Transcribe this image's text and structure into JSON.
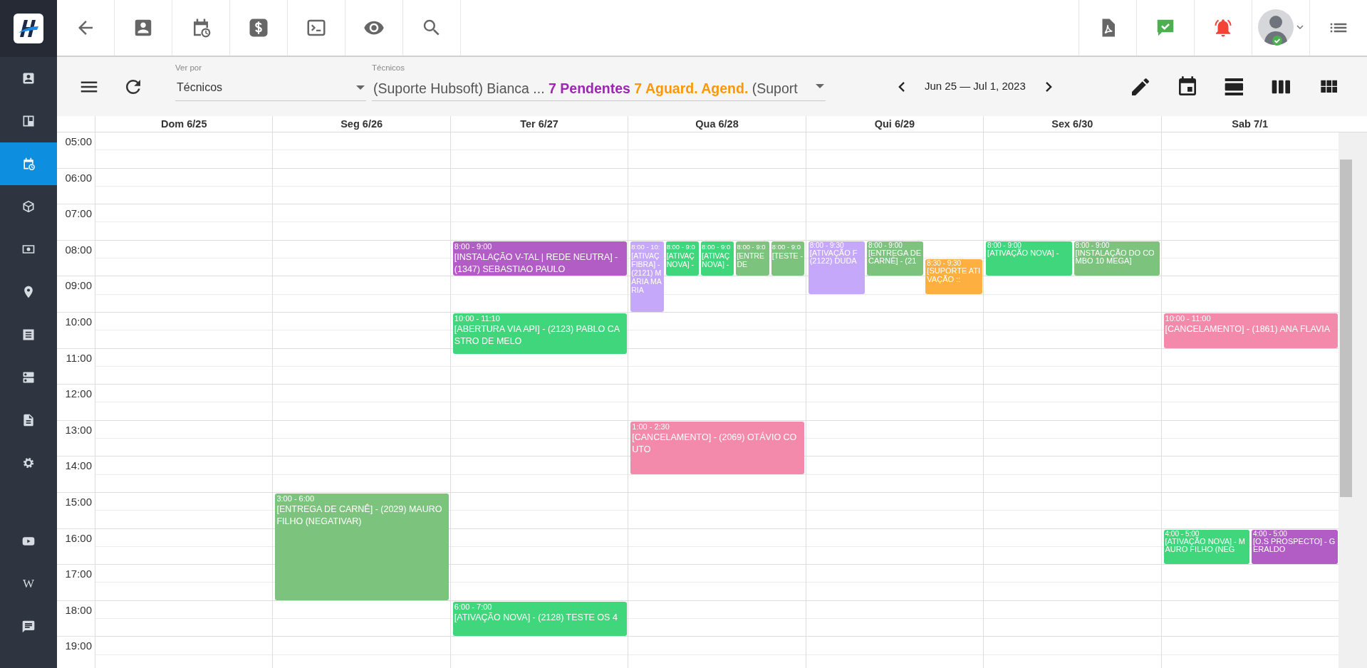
{
  "sidebar": {
    "items": [
      {
        "selected": false
      },
      {
        "selected": false
      },
      {
        "selected": true
      },
      {
        "selected": false
      },
      {
        "selected": false
      },
      {
        "selected": false
      },
      {
        "selected": false
      },
      {
        "selected": false
      },
      {
        "selected": false
      },
      {
        "selected": false
      },
      {
        "selected": false
      },
      {
        "selected": false,
        "label": "W"
      },
      {
        "selected": false
      }
    ]
  },
  "toolbar": {
    "view_by": {
      "label": "Ver por",
      "value": "Técnicos"
    },
    "technicians": {
      "label": "Técnicos",
      "prefix": "(Suporte Hubsoft) Bianca ...",
      "pending": "7 Pendentes",
      "awaiting": "7 Aguard. Agend.",
      "suffix": "(Suport"
    },
    "date_range": "Jun 25 — Jul 1, 2023"
  },
  "calendar": {
    "times": [
      "05:00",
      "06:00",
      "07:00",
      "08:00",
      "09:00",
      "10:00",
      "11:00",
      "12:00",
      "13:00",
      "14:00",
      "15:00",
      "16:00",
      "17:00",
      "18:00",
      "19:00"
    ],
    "days": [
      {
        "label": "Dom 6/25"
      },
      {
        "label": "Seg 6/26",
        "events": [
          {
            "time": "3:00 - 6:00",
            "title": "[ENTREGA DE CARNÊ] - (2029) MAURO FILHO (NEGATIVAR)",
            "color": "#7cc47e"
          }
        ]
      },
      {
        "label": "Ter 6/27",
        "events": [
          {
            "time": "8:00 - 9:00",
            "title": "[INSTALAÇÃO V-TAL | REDE NEUTRA] - (1347) SEBASTIAO PAULO",
            "color": "#b25cc5"
          },
          {
            "time": "10:00 - 11:10",
            "title": "[ABERTURA VIA API] - (2123) PABLO CASTRO DE MELO",
            "color": "#40d67c"
          },
          {
            "time": "6:00 - 7:00",
            "title": "[ATIVAÇÃO NOVA] - (2128) TESTE OS 4",
            "color": "#40d67c"
          }
        ]
      },
      {
        "label": "Qua 6/28",
        "events": [
          {
            "time": "8:00 - 10:",
            "title": "[ATIVAÇ FIBRA] - (2121) MARIA MARIA",
            "color": "#c6a8fb"
          },
          {
            "time": "8:00 - 9:0",
            "title": "[ATIVAÇ NOVA] -",
            "color": "#40d67c"
          },
          {
            "time": "8:00 - 9:0",
            "title": "[ATIVAÇ NOVA] -",
            "color": "#40d67c"
          },
          {
            "time": "8:00 - 9:0",
            "title": "[ENTRE DE",
            "color": "#7cc47e"
          },
          {
            "time": "8:00 - 9:0",
            "title": "[TESTE -",
            "color": "#7cc47e"
          },
          {
            "time": "1:00 - 2:30",
            "title": "[CANCELAMENTO] - (2069) OTÁVIO COUTO",
            "color": "#f48aab"
          }
        ]
      },
      {
        "label": "Qui 6/29",
        "events": [
          {
            "time": "8:00 - 9:30",
            "title": "[ATIVAÇÃO F (2122) DUDA",
            "color": "#c6a8fb"
          },
          {
            "time": "8:00 - 9:00",
            "title": "[ENTREGA DE CARNÊ] - (21",
            "color": "#7cc47e"
          },
          {
            "time": "8:30 - 9:30",
            "title": "[SUPORTE ATIVAÇÃO ::",
            "color": "#fdb03f"
          }
        ]
      },
      {
        "label": "Sex 6/30",
        "events": [
          {
            "time": "8:00 - 9:00",
            "title": "[ATIVAÇÃO NOVA] -",
            "color": "#40d67c"
          },
          {
            "time": "8:00 - 9:00",
            "title": "[INSTALAÇÃO DO COMBO 10 MEGA]",
            "color": "#7cc47e"
          }
        ]
      },
      {
        "label": "Sab 7/1",
        "events": [
          {
            "time": "10:00 - 11:00",
            "title": "[CANCELAMENTO] - (1861) ANA FLAVIA",
            "color": "#f48aab"
          },
          {
            "time": "4:00 - 5:00",
            "title": "[ATIVAÇÃO NOVA] - MAURO FILHO (NEG",
            "color": "#40d67c"
          },
          {
            "time": "4:00 - 5:00",
            "title": "[O.S PROSPECTO] - GERALDO",
            "color": "#b25cc5"
          }
        ]
      }
    ]
  }
}
